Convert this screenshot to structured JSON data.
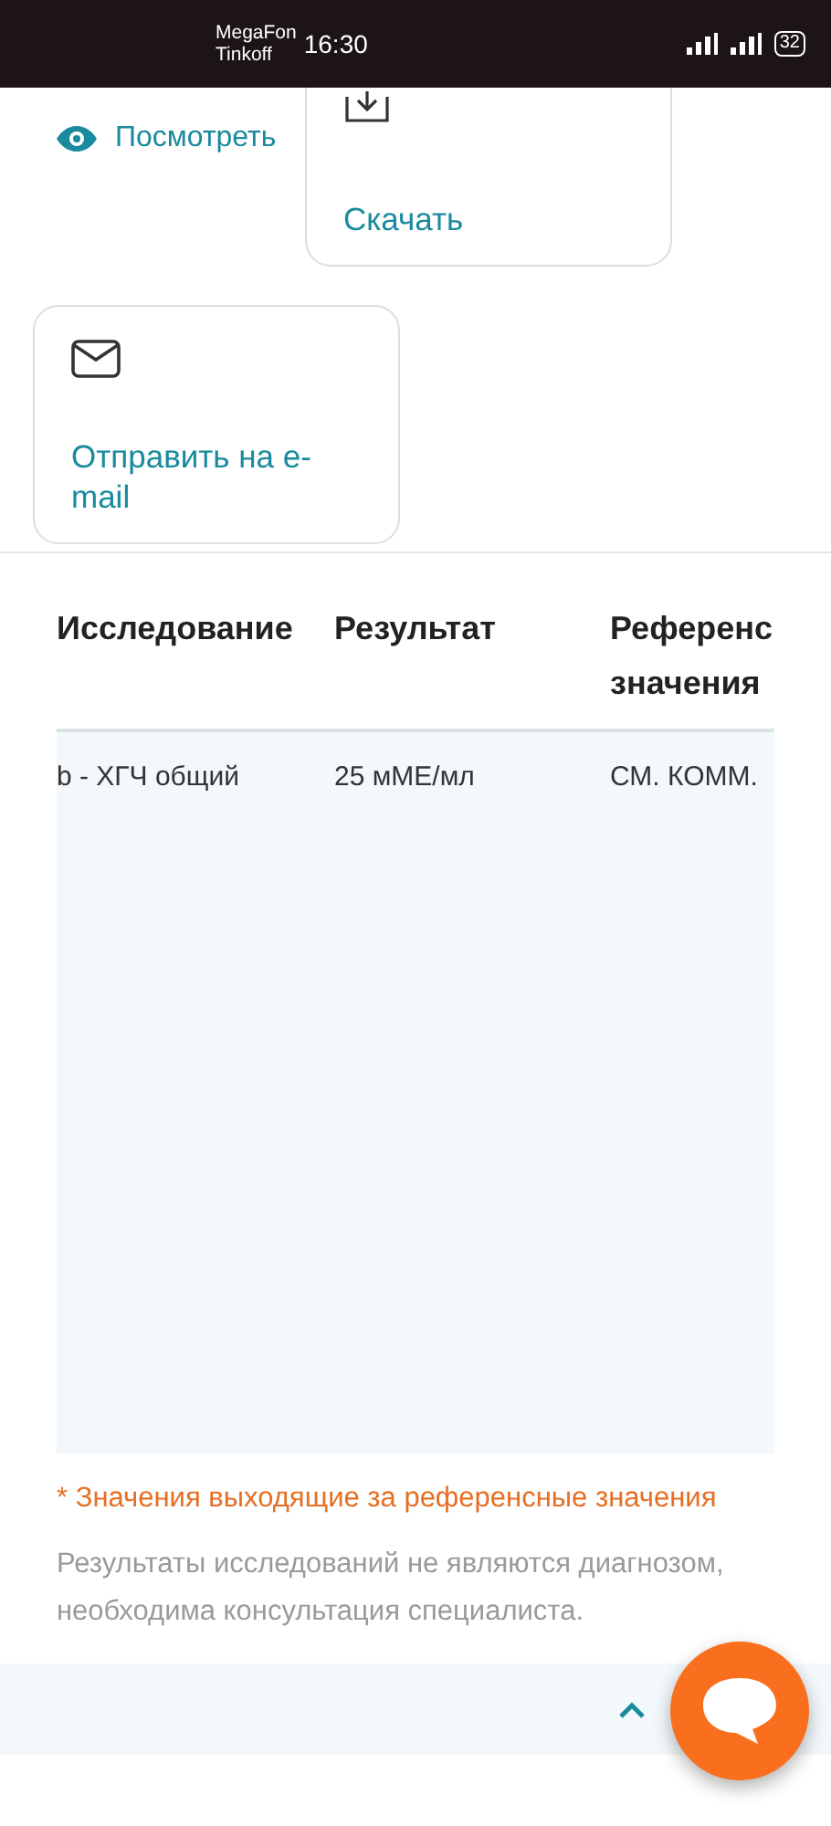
{
  "status_bar": {
    "carriers": [
      "MegaFon",
      "Tinkoff"
    ],
    "time": "16:30",
    "battery": "32"
  },
  "actions": [
    {
      "kind": "link",
      "label": "Посмотреть"
    },
    {
      "kind": "card",
      "label": "Скачать"
    },
    {
      "kind": "card",
      "label": "Отправить на e-mail"
    }
  ],
  "table": {
    "columns": [
      "Исследование",
      "Результат",
      "Референс значения"
    ],
    "rows": [
      [
        "b - ХГЧ общий",
        "25 мМЕ/мл",
        "СМ. КОММ."
      ]
    ]
  },
  "footnote": "* Значения выходящие за референсные значения",
  "disclaimer": "Результаты исследований не являются диагнозом, необходима консультация специалиста."
}
